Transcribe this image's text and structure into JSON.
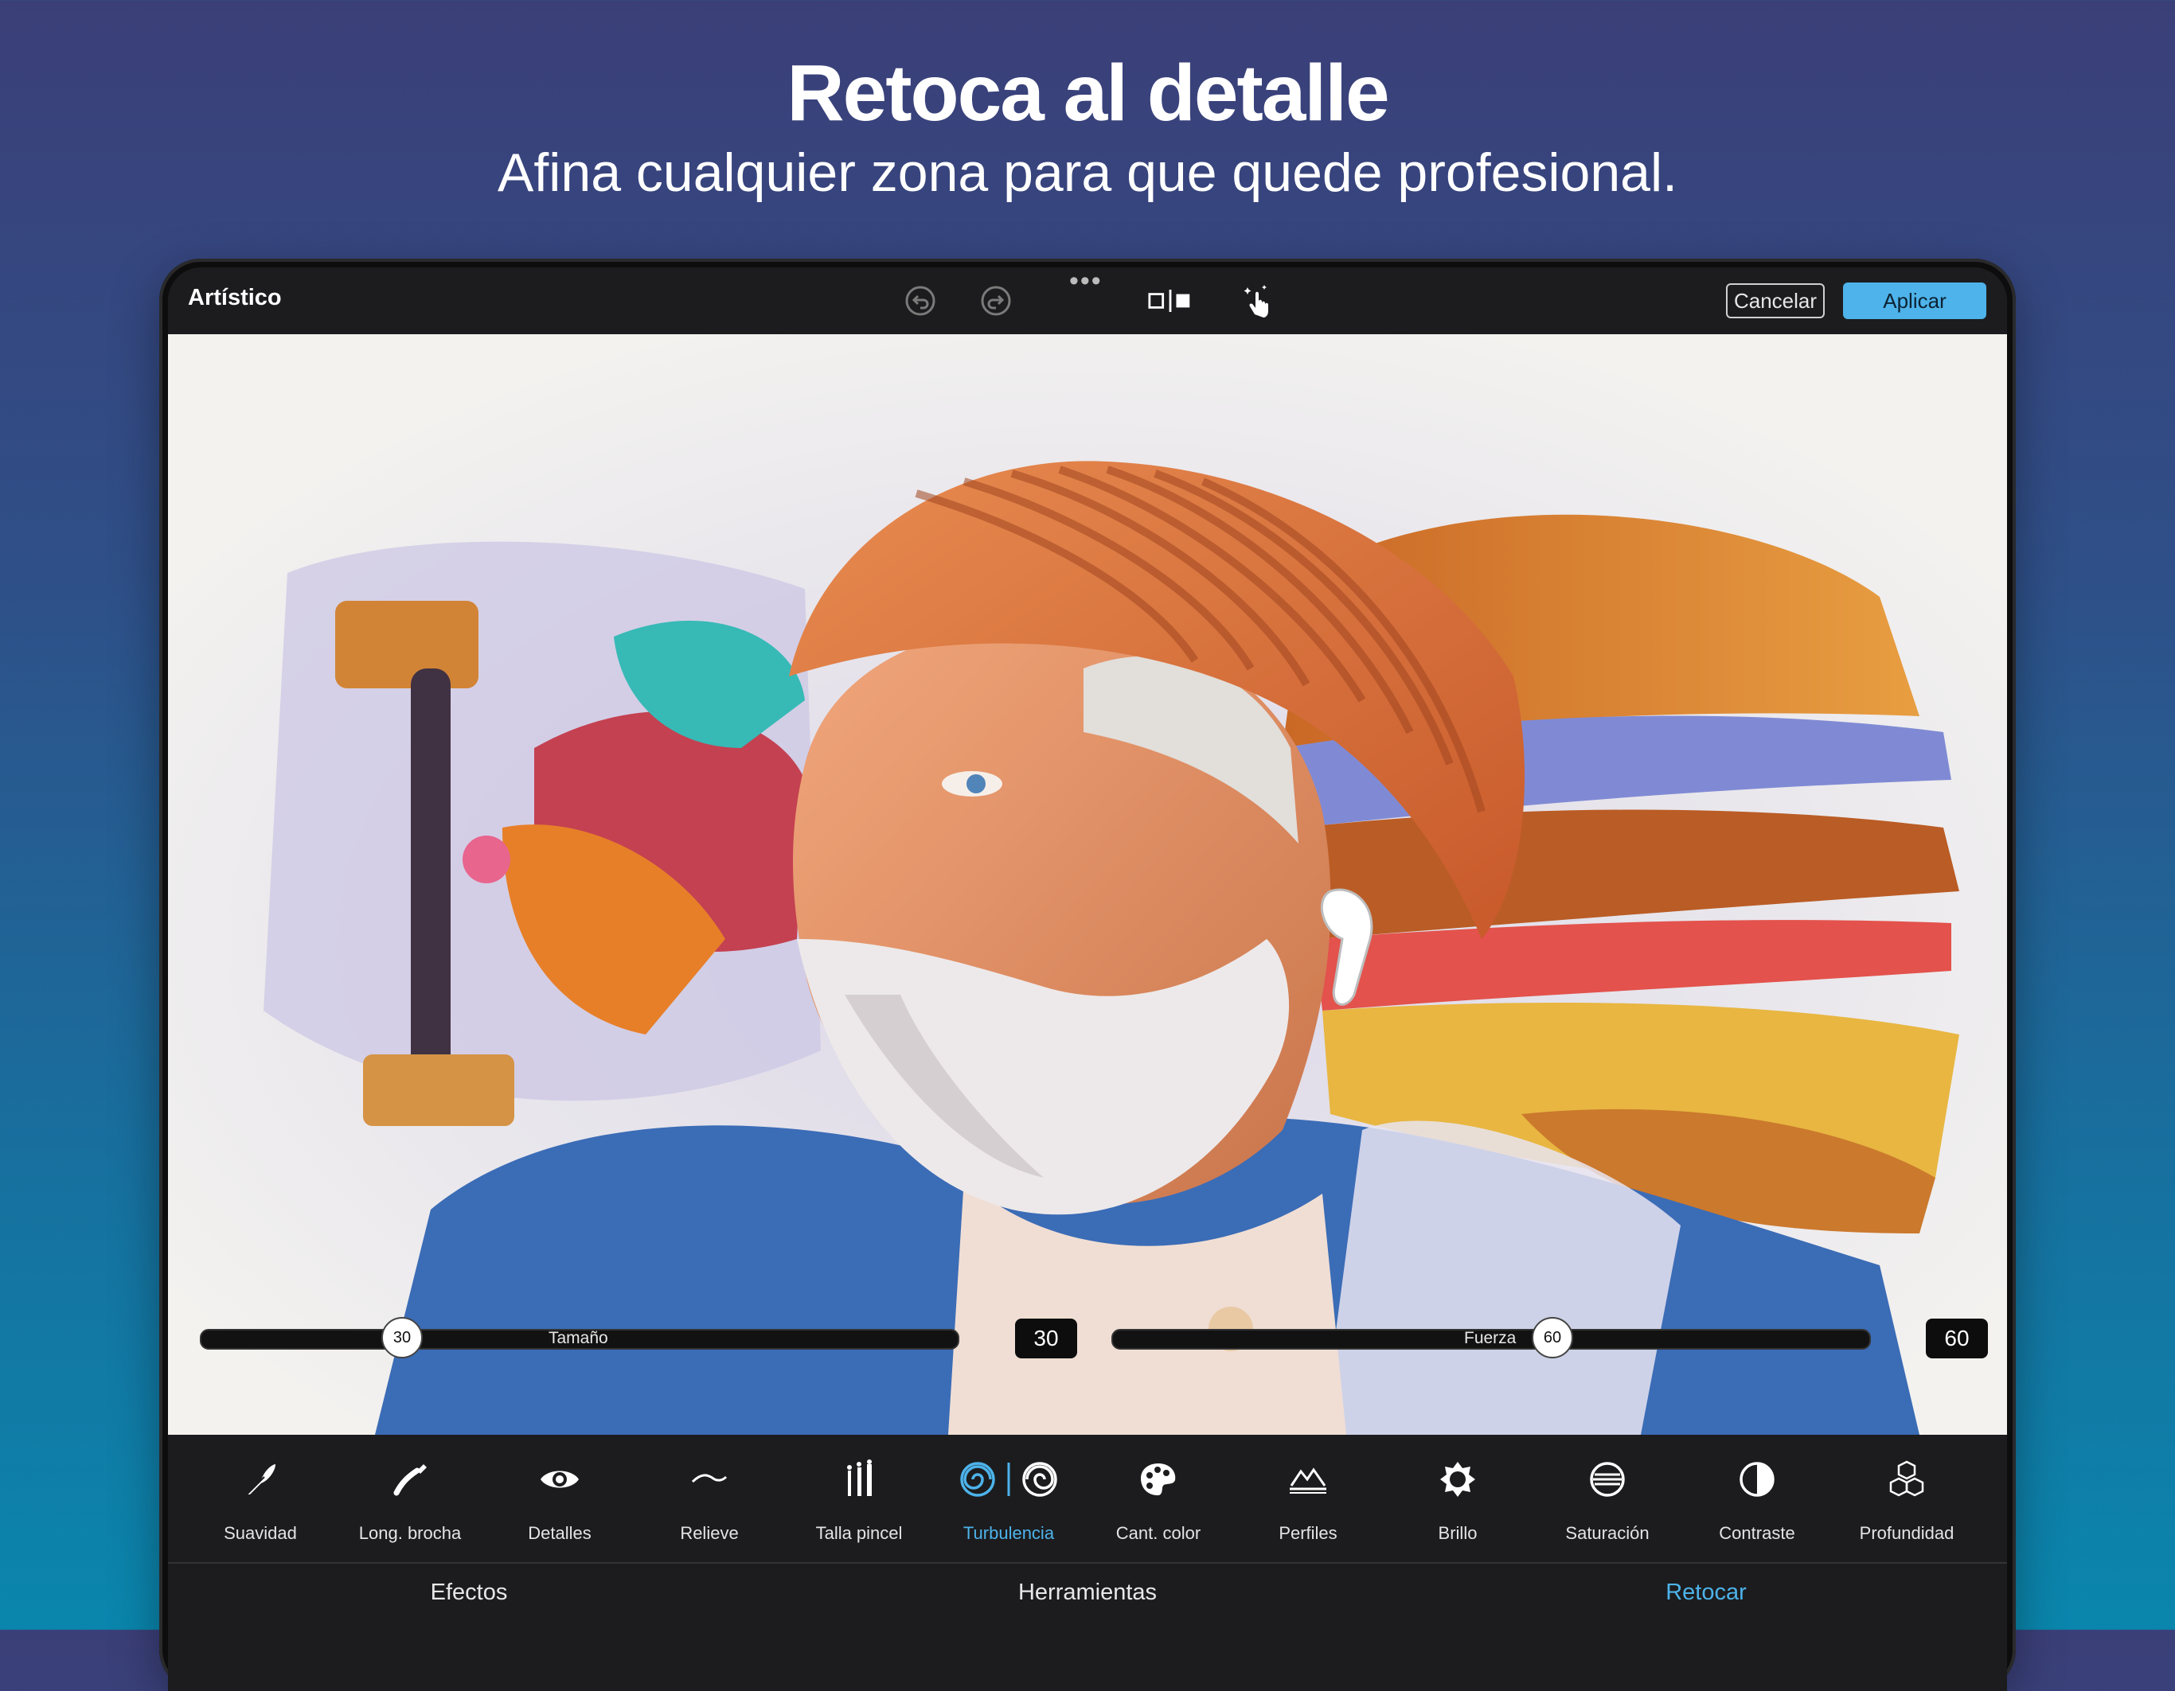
{
  "headline": "Retoca al detalle",
  "subheadline": "Afina cualquier zona para que quede profesional.",
  "app": {
    "title": "Artístico",
    "toolbar": {
      "undo_icon": "undo-icon",
      "redo_icon": "redo-icon",
      "more_icon": "more-dots-icon",
      "compare_icon": "split-view-icon",
      "touch_icon": "magic-touch-icon",
      "cancel_label": "Cancelar",
      "apply_label": "Aplicar"
    },
    "sliders": {
      "size": {
        "label": "Tamaño",
        "value": "30",
        "display": "30"
      },
      "strength": {
        "label": "Fuerza",
        "value": "60",
        "display": "60"
      }
    },
    "tools": [
      {
        "label": "Suavidad",
        "icon": "feather-icon"
      },
      {
        "label": "Long. brocha",
        "icon": "brush-stroke-icon"
      },
      {
        "label": "Detalles",
        "icon": "eye-icon"
      },
      {
        "label": "Relieve",
        "icon": "wave-icon"
      },
      {
        "label": "Talla pincel",
        "icon": "brushes-icon"
      },
      {
        "label": "Turbulencia",
        "icon": "swirl-icon",
        "active": true
      },
      {
        "label": "Cant. color",
        "icon": "palette-icon"
      },
      {
        "label": "Perfiles",
        "icon": "mountain-icon"
      },
      {
        "label": "Brillo",
        "icon": "sun-icon"
      },
      {
        "label": "Saturación",
        "icon": "saturation-icon"
      },
      {
        "label": "Contraste",
        "icon": "contrast-icon"
      },
      {
        "label": "Profundidad",
        "icon": "cubes-icon"
      }
    ],
    "tabs": [
      {
        "label": "Efectos"
      },
      {
        "label": "Herramientas"
      },
      {
        "label": "Retocar",
        "active": true
      }
    ],
    "colors": {
      "accent": "#4db3ea",
      "bar": "#1c1c1e"
    }
  }
}
